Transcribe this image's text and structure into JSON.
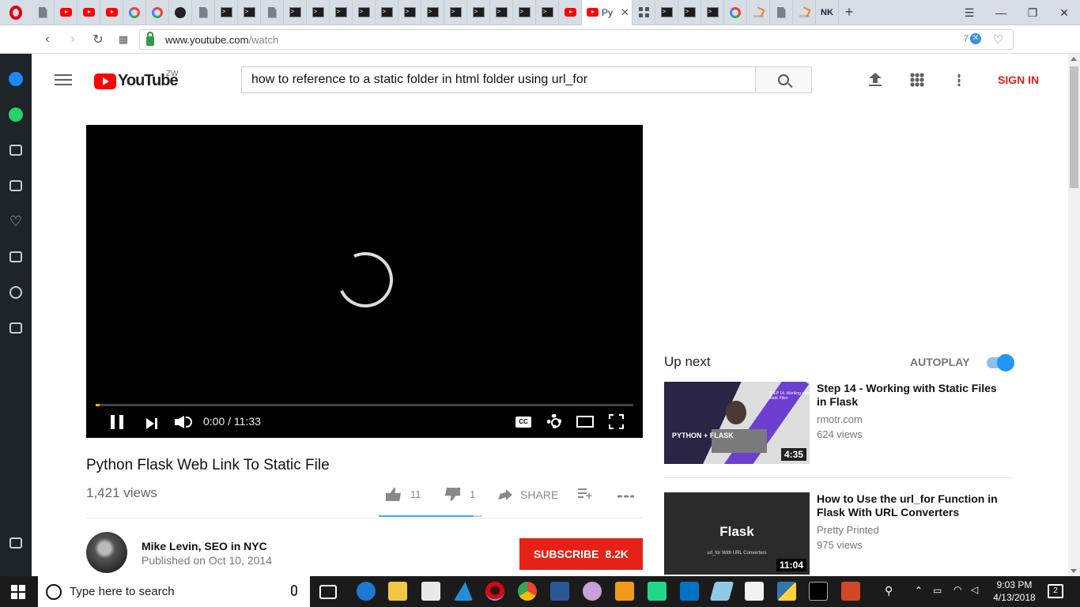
{
  "browser": {
    "active_tab_title": "Py",
    "url_host": "www.youtube.com",
    "url_path": "/watch",
    "badge_count": "7",
    "nk_label": "NK",
    "tabs": [
      "doc",
      "yt",
      "yt",
      "yt",
      "g",
      "g",
      "gh",
      "doc",
      "term",
      "term",
      "doc",
      "term",
      "term",
      "term",
      "term",
      "term",
      "term",
      "term",
      "term",
      "term",
      "term",
      "term",
      "term",
      "yt"
    ],
    "tabs_after": [
      "grid",
      "term",
      "term",
      "term",
      "g",
      "so",
      "doc",
      "so"
    ]
  },
  "youtube": {
    "country_code": "ZW",
    "logo_text": "YouTube",
    "search_query": "how to reference to a static folder in html folder using url_for",
    "sign_in": "SIGN IN",
    "player": {
      "current_time": "0:00",
      "duration": "11:33",
      "time_display": "0:00 / 11:33",
      "progress_fraction": 0.008,
      "cc_label": "CC"
    },
    "video": {
      "title": "Python Flask Web Link To Static File",
      "views": "1,421 views",
      "likes": "11",
      "dislikes": "1",
      "share_label": "SHARE",
      "like_fraction": 0.917
    },
    "channel": {
      "name": "Mike Levin, SEO in NYC",
      "published": "Published on Oct 10, 2014",
      "subscribe_label": "SUBSCRIBE",
      "subscriber_count": "8.2K"
    },
    "up_next": {
      "label": "Up next",
      "autoplay_label": "AUTOPLAY",
      "autoplay_on": true,
      "items": [
        {
          "title": "Step 14 - Working with Static Files in Flask",
          "channel": "rmotr.com",
          "views": "624 views",
          "duration": "4:35",
          "thumb_brand": "PYTHON + FLASK",
          "thumb_step": "STEP 14. Working with Static Files"
        },
        {
          "title": "How to Use the url_for Function in Flask With URL Converters",
          "channel": "Pretty Printed",
          "views": "975 views",
          "duration": "11:04",
          "thumb_title": "Flask",
          "thumb_sub": "url_for With URL Converters"
        }
      ]
    }
  },
  "taskbar": {
    "search_placeholder": "Type here to search",
    "time": "9:03 PM",
    "date": "4/13/2018",
    "notification_count": "2"
  }
}
